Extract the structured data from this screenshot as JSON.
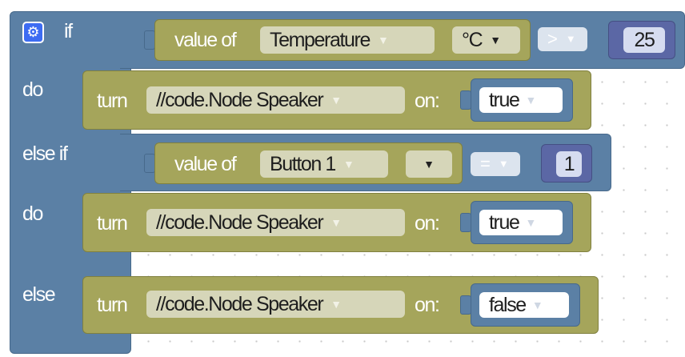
{
  "control": {
    "if_label": "if",
    "do_label": "do",
    "else_if_label": "else if",
    "else_label": "else",
    "gear_icon": "gear-icon"
  },
  "condition_1": {
    "value_of_label": "value of",
    "sensor": "Temperature",
    "unit": "°C",
    "operator": ">",
    "number": "25"
  },
  "action_1": {
    "turn_label": "turn",
    "device": "//code.Node Speaker",
    "on_label": "on:",
    "value": "true"
  },
  "condition_2": {
    "value_of_label": "value of",
    "sensor": "Button 1",
    "unit": "",
    "operator": "=",
    "number": "1"
  },
  "action_2": {
    "turn_label": "turn",
    "device": "//code.Node Speaker",
    "on_label": "on:",
    "value": "true"
  },
  "action_3": {
    "turn_label": "turn",
    "device": "//code.Node Speaker",
    "on_label": "on:",
    "value": "false"
  },
  "colors": {
    "control_block": "#5b80a5",
    "action_block": "#a5a55b",
    "number_block": "#5b67a5",
    "gear": "#3d6cf2"
  }
}
